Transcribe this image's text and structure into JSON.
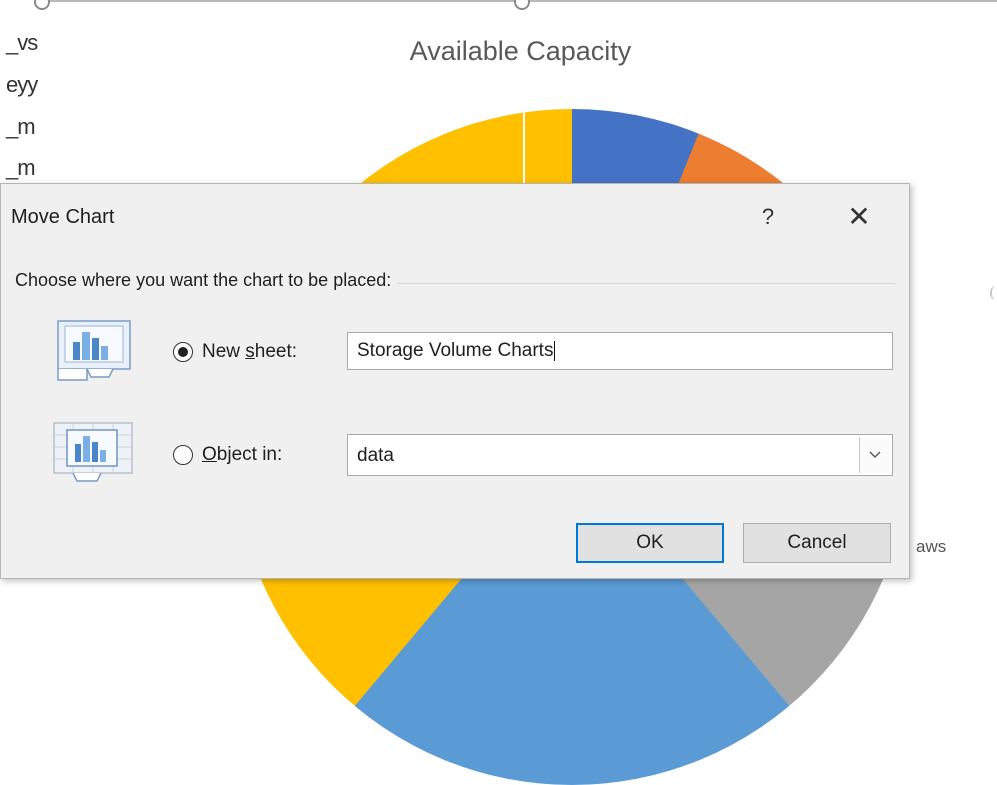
{
  "background": {
    "cell_fragments": [
      "_vs",
      "eyy",
      "_m",
      "_m"
    ],
    "chart_title": "Available Capacity",
    "right_label": "aws",
    "slice_colors": [
      "#4472c4",
      "#ed7d31",
      "#a5a5a5",
      "#5b9bd5",
      "#ffc000"
    ]
  },
  "dialog": {
    "title": "Move Chart",
    "help_label": "?",
    "close_label": "✕",
    "prompt": "Choose where you want the chart to be placed:",
    "new_sheet": {
      "label_prefix": "New ",
      "label_accel": "s",
      "label_suffix": "heet:",
      "selected": true,
      "value": "Storage Volume Charts"
    },
    "object_in": {
      "label_accel": "O",
      "label_suffix": "bject in:",
      "selected": false,
      "value": "data"
    },
    "ok_label": "OK",
    "cancel_label": "Cancel",
    "accent_color": "#0078d7"
  }
}
